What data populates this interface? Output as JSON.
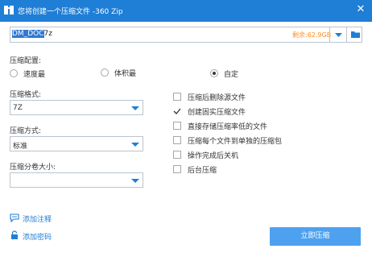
{
  "window": {
    "title": "您将创建一个压缩文件 -360 Zip",
    "close_symbol": "✕"
  },
  "path": {
    "selected": "DM_DOC",
    "rest": "7z",
    "free_space": "剩余:62.9GB"
  },
  "compress_config": {
    "label": "压缩配置:",
    "options": [
      {
        "label": "速度最",
        "checked": false
      },
      {
        "label": "体积最",
        "checked": false
      },
      {
        "label": "自定",
        "checked": true
      }
    ]
  },
  "format": {
    "label": "压缩格式:",
    "value": "7Z"
  },
  "method": {
    "label": "压缩方式:",
    "value": "标准"
  },
  "split": {
    "label": "压缩分卷大小:",
    "value": ""
  },
  "options": [
    {
      "label": "压缩后删除源文件",
      "checked": false
    },
    {
      "label": "创建固实压缩文件",
      "checked": true
    },
    {
      "label": "直接存储压缩率低的文件",
      "checked": false
    },
    {
      "label": "压缩每个文件到单独的压缩包",
      "checked": false
    },
    {
      "label": "操作完成后关机",
      "checked": false
    },
    {
      "label": "后台压缩",
      "checked": false
    }
  ],
  "links": {
    "add_comment": "添加注释",
    "add_password": "添加密码"
  },
  "start_button": "立即压缩",
  "colors": {
    "titlebar": "#1f7ed6",
    "primary_button": "#4ea1ef",
    "free_space": "#ff8a1f",
    "link": "#1f7ed6"
  },
  "icons": [
    "app-icon",
    "close-icon",
    "dropdown-arrow-icon",
    "folder-icon",
    "comment-icon",
    "lock-icon",
    "checkmark-icon"
  ]
}
